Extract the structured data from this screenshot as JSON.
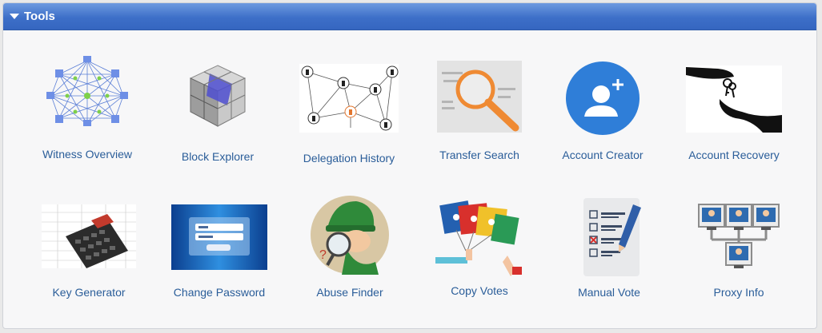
{
  "panel": {
    "title": "Tools"
  },
  "tools": [
    {
      "label": "Witness Overview",
      "icon": "network-icon"
    },
    {
      "label": "Block Explorer",
      "icon": "cube-icon"
    },
    {
      "label": "Delegation History",
      "icon": "graph-icon"
    },
    {
      "label": "Transfer Search",
      "icon": "magnifier-icon"
    },
    {
      "label": "Account Creator",
      "icon": "add-user-icon"
    },
    {
      "label": "Account Recovery",
      "icon": "key-hand-icon"
    },
    {
      "label": "Key Generator",
      "icon": "calculator-icon"
    },
    {
      "label": "Change Password",
      "icon": "login-screen-icon"
    },
    {
      "label": "Abuse Finder",
      "icon": "detective-icon"
    },
    {
      "label": "Copy Votes",
      "icon": "floppy-disks-icon"
    },
    {
      "label": "Manual Vote",
      "icon": "checklist-icon"
    },
    {
      "label": "Proxy Info",
      "icon": "proxy-network-icon"
    }
  ],
  "colors": {
    "header": "#3d6fc8",
    "label": "#2a5d99"
  }
}
